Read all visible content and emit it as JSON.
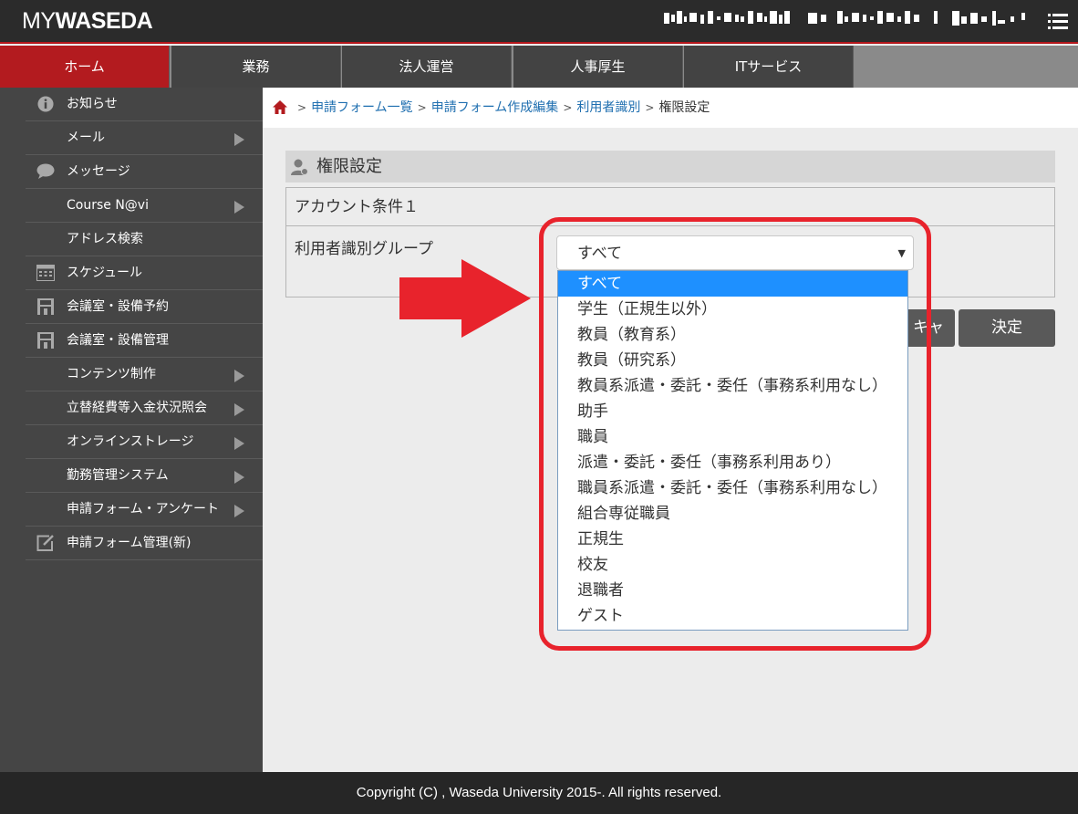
{
  "header": {
    "logo_my": "MY",
    "logo_waseda": "WASEDA"
  },
  "nav": {
    "tabs": [
      {
        "label": "ホーム",
        "active": true
      },
      {
        "label": "業務"
      },
      {
        "label": "法人運営"
      },
      {
        "label": "人事厚生"
      },
      {
        "label": "ITサービス"
      }
    ]
  },
  "sidebar": {
    "items": [
      {
        "label": "お知らせ",
        "icon": "info-icon"
      },
      {
        "label": "メール",
        "submenu": true
      },
      {
        "label": "メッセージ",
        "icon": "speech-bubble-icon"
      },
      {
        "label": "Course N@vi",
        "submenu": true
      },
      {
        "label": "アドレス検索"
      },
      {
        "label": "スケジュール",
        "icon": "calendar-icon"
      },
      {
        "label": "会議室・設備予約",
        "icon": "facility-icon"
      },
      {
        "label": "会議室・設備管理",
        "icon": "facility-icon"
      },
      {
        "label": "コンテンツ制作",
        "submenu": true
      },
      {
        "label": "立替経費等入金状況照会",
        "submenu": true
      },
      {
        "label": "オンラインストレージ",
        "submenu": true
      },
      {
        "label": "勤務管理システム",
        "submenu": true
      },
      {
        "label": "申請フォーム・アンケート",
        "submenu": true
      },
      {
        "label": "申請フォーム管理(新)",
        "icon": "edit-icon"
      }
    ]
  },
  "breadcrumb": {
    "items": [
      "申請フォーム一覧",
      "申請フォーム作成編集",
      "利用者識別"
    ],
    "current": "権限設定",
    "separator": ">"
  },
  "panel": {
    "title": "権限設定",
    "account_condition": "アカウント条件１",
    "group_label": "利用者識別グループ",
    "select_value": "すべて",
    "cancel_label": "キャンセル",
    "ok_label": "決定"
  },
  "dropdown": {
    "options": [
      "すべて",
      "学生（正規生以外）",
      "教員（教育系）",
      "教員（研究系）",
      "教員系派遣・委託・委任（事務系利用なし）",
      "助手",
      "職員",
      "派遣・委託・委任（事務系利用あり）",
      "職員系派遣・委託・委任（事務系利用なし）",
      "組合専従職員",
      "正規生",
      "校友",
      "退職者",
      "ゲスト"
    ],
    "selected": "すべて"
  },
  "footer": {
    "copyright": "Copyright (C) , Waseda University 2015-. All rights reserved."
  },
  "colors": {
    "brand_red": "#b31b1f",
    "annotation_red": "#e8232c",
    "select_highlight": "#1e90ff"
  }
}
